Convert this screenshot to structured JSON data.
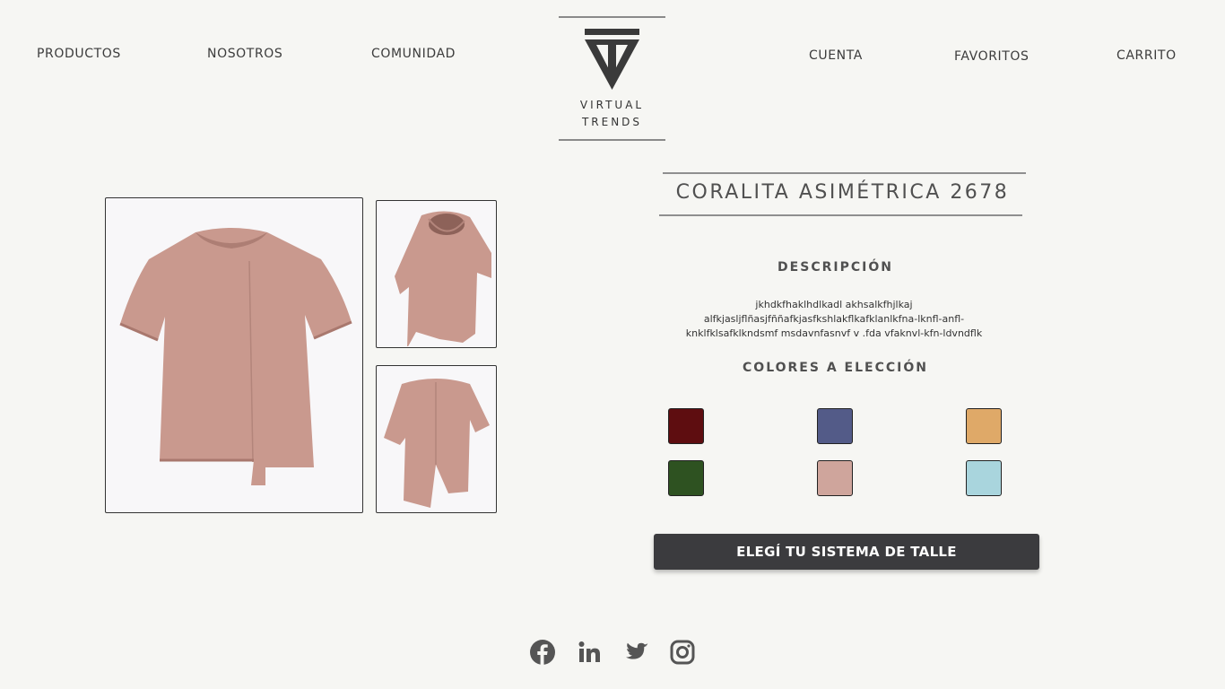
{
  "nav": {
    "left": [
      "PRODUCTOS",
      "NOSOTROS",
      "COMUNIDAD"
    ],
    "right": [
      "CUENTA",
      "FAVORITOS",
      "CARRITO"
    ]
  },
  "logo": {
    "line1": "VIRTUAL",
    "line2": "TRENDS"
  },
  "product": {
    "title": "CORALITA ASIMÉTRICA 2678",
    "description_heading": "DESCRIPCIÓN",
    "description_lines": [
      "jkhdkfhaklhdlkadl akhsalkfhjlkaj",
      "alfkjasljflñasjfññafkjasfkshlakflkafklanlkfna-lknfl-anfl-",
      "knklfklsafklkndsmf msdavnfasnvf v .fda vfaknvl-kfn-ldvndflk"
    ],
    "colors_heading": "COLORES A ELECCIÓN",
    "colors": [
      "#5e0d10",
      "#535b88",
      "#dfa968",
      "#2e5221",
      "#cfa59c",
      "#a9d5dd"
    ],
    "size_button": "ELEGÍ TU SISTEMA DE TALLE"
  },
  "colors": {
    "background": "#f6f6f3",
    "shirt": "#c9998e",
    "button": "#3b3b3e",
    "text": "#505050"
  },
  "social": [
    "facebook-icon",
    "linkedin-icon",
    "twitter-icon",
    "instagram-icon"
  ]
}
